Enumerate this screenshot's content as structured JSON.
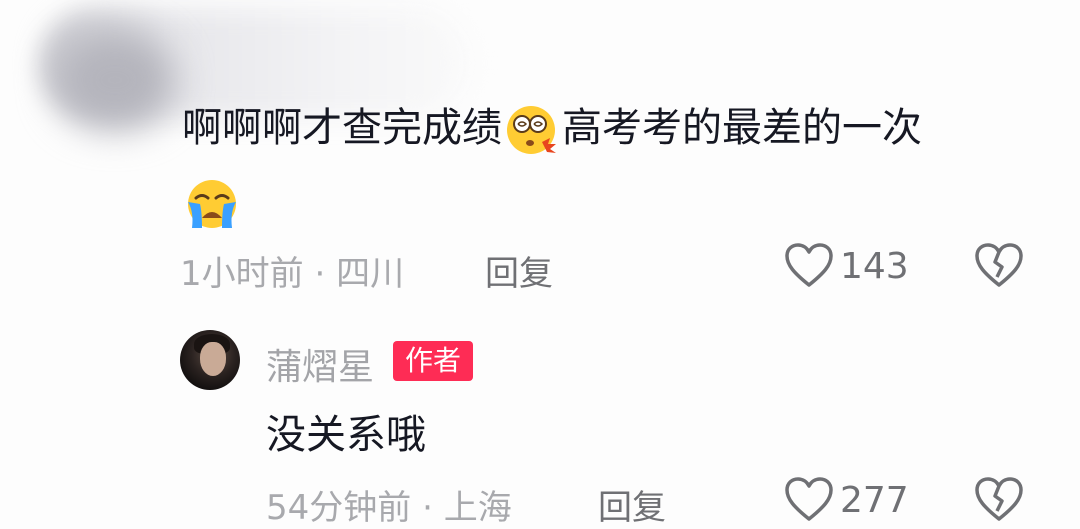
{
  "comment": {
    "text_before": "啊啊啊才查完成绩",
    "text_after": "高考考的最差的一次",
    "time": "1小时前",
    "location": "四川",
    "reply_label": "回复",
    "likes": "143"
  },
  "reply": {
    "author": "蒲熠星",
    "badge": "作者",
    "text": "没关系哦",
    "time": "54分钟前",
    "location": "上海",
    "reply_label": "回复",
    "likes": "277"
  },
  "icons": {
    "emoji_1": "dizzy-face-emoji",
    "emoji_2": "loudly-crying-face-emoji",
    "like": "heart-outline-icon",
    "dislike": "broken-heart-outline-icon"
  },
  "colors": {
    "badge": "#fe2c55",
    "primary_text": "#161823",
    "meta_text": "#a8a9ad"
  }
}
